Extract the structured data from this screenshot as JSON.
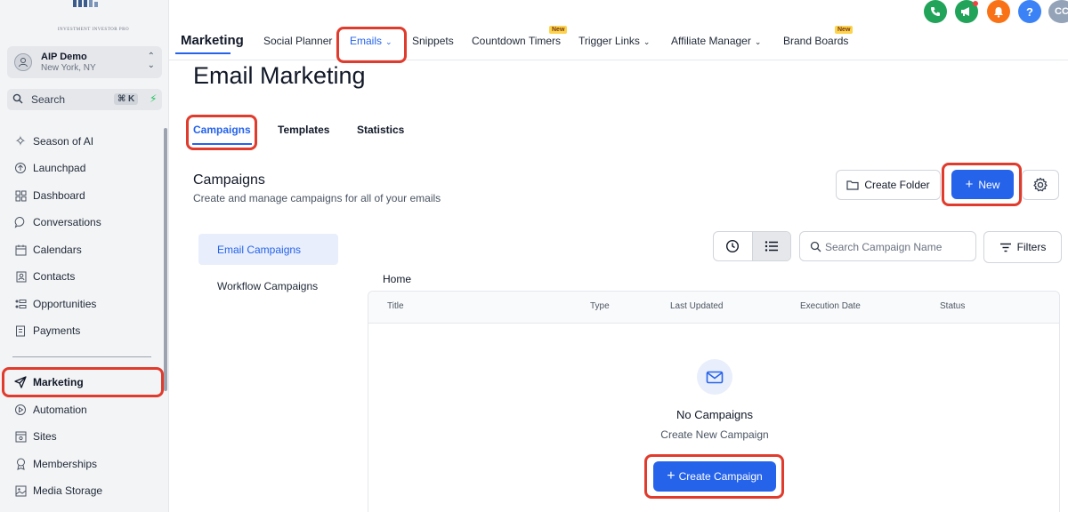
{
  "colors": {
    "accent": "#2563eb",
    "highlight": "#e03b2c",
    "new_badge": "#fcd34d"
  },
  "brand": {
    "logo_text": "INVESTMENT INVESTOR PRO"
  },
  "account": {
    "name": "AIP Demo",
    "location": "New York, NY"
  },
  "search": {
    "label": "Search",
    "shortcut": "⌘ K"
  },
  "sidebar": {
    "items": [
      {
        "label": "Season of AI",
        "icon": "sparkle-icon"
      },
      {
        "label": "Launchpad",
        "icon": "rocket-icon"
      },
      {
        "label": "Dashboard",
        "icon": "grid-icon"
      },
      {
        "label": "Conversations",
        "icon": "chat-icon"
      },
      {
        "label": "Calendars",
        "icon": "calendar-icon"
      },
      {
        "label": "Contacts",
        "icon": "contacts-icon"
      },
      {
        "label": "Opportunities",
        "icon": "opportunities-icon"
      },
      {
        "label": "Payments",
        "icon": "payments-icon"
      },
      {
        "label": "Marketing",
        "icon": "send-icon"
      },
      {
        "label": "Automation",
        "icon": "automation-icon"
      },
      {
        "label": "Sites",
        "icon": "sites-icon"
      },
      {
        "label": "Memberships",
        "icon": "badge-icon"
      },
      {
        "label": "Media Storage",
        "icon": "image-icon"
      }
    ]
  },
  "topbar": {
    "section": "Marketing",
    "nav": [
      {
        "label": "Social Planner"
      },
      {
        "label": "Emails"
      },
      {
        "label": "Snippets"
      },
      {
        "label": "Countdown Timers",
        "badge": "New"
      },
      {
        "label": "Trigger Links"
      },
      {
        "label": "Affiliate Manager"
      },
      {
        "label": "Brand Boards",
        "badge": "New"
      }
    ],
    "user_initials": "CC",
    "help_label": "?"
  },
  "page": {
    "title": "Email Marketing",
    "tabs": [
      {
        "label": "Campaigns"
      },
      {
        "label": "Templates"
      },
      {
        "label": "Statistics"
      }
    ],
    "section_title": "Campaigns",
    "section_subtitle": "Create and manage campaigns for all of your emails",
    "create_folder_label": "Create Folder",
    "new_label": "New",
    "side_tabs": [
      {
        "label": "Email Campaigns"
      },
      {
        "label": "Workflow Campaigns"
      }
    ],
    "search_placeholder": "Search Campaign Name",
    "filters_label": "Filters",
    "breadcrumb": "Home",
    "columns": [
      "Title",
      "Type",
      "Last Updated",
      "Execution Date",
      "Status"
    ],
    "empty": {
      "title": "No Campaigns",
      "subtitle": "Create New Campaign",
      "button": "Create Campaign"
    }
  }
}
